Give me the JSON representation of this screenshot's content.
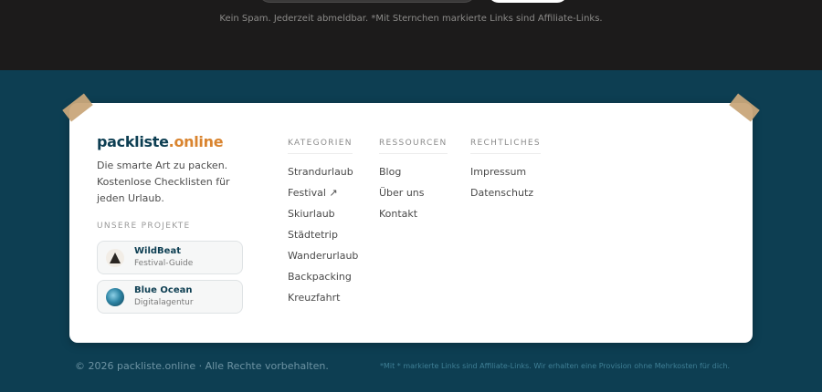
{
  "newsletter": {
    "note": "Kein Spam. Jederzeit abmeldbar. *Mit Sternchen markierte Links sind Affiliate-Links."
  },
  "brand": {
    "name": "packliste",
    "tld": ".online",
    "tagline": "Die smarte Art zu packen. Kostenlose Checklisten für jeden Urlaub."
  },
  "projects": {
    "title": "UNSERE PROJEKTE",
    "items": [
      {
        "name": "WildBeat",
        "subtitle": "Festival-Guide",
        "icon": "wildbeat-logo"
      },
      {
        "name": "Blue Ocean",
        "subtitle": "Digitalagentur",
        "icon": "blue-ocean-logo"
      }
    ]
  },
  "columns": [
    {
      "title": "KATEGORIEN",
      "links": [
        "Strandurlaub",
        "Festival ↗",
        "Skiurlaub",
        "Städtetrip",
        "Wanderurlaub",
        "Backpacking",
        "Kreuzfahrt"
      ]
    },
    {
      "title": "RESSOURCEN",
      "links": [
        "Blog",
        "Über uns",
        "Kontakt"
      ]
    },
    {
      "title": "RECHTLICHES",
      "links": [
        "Impressum",
        "Datenschutz"
      ]
    }
  ],
  "bottom": {
    "copyright": "© 2026 packliste.online · Alle Rechte vorbehalten.",
    "disclaimer": "*Mit * markierte Links sind Affiliate-Links. Wir erhalten eine Provision ohne Mehrkosten für dich."
  },
  "colors": {
    "footer_bg": "#0d3e52",
    "top_bg": "#1c1b1b",
    "accent": "#d9842f",
    "tape": "#c9a77a"
  }
}
